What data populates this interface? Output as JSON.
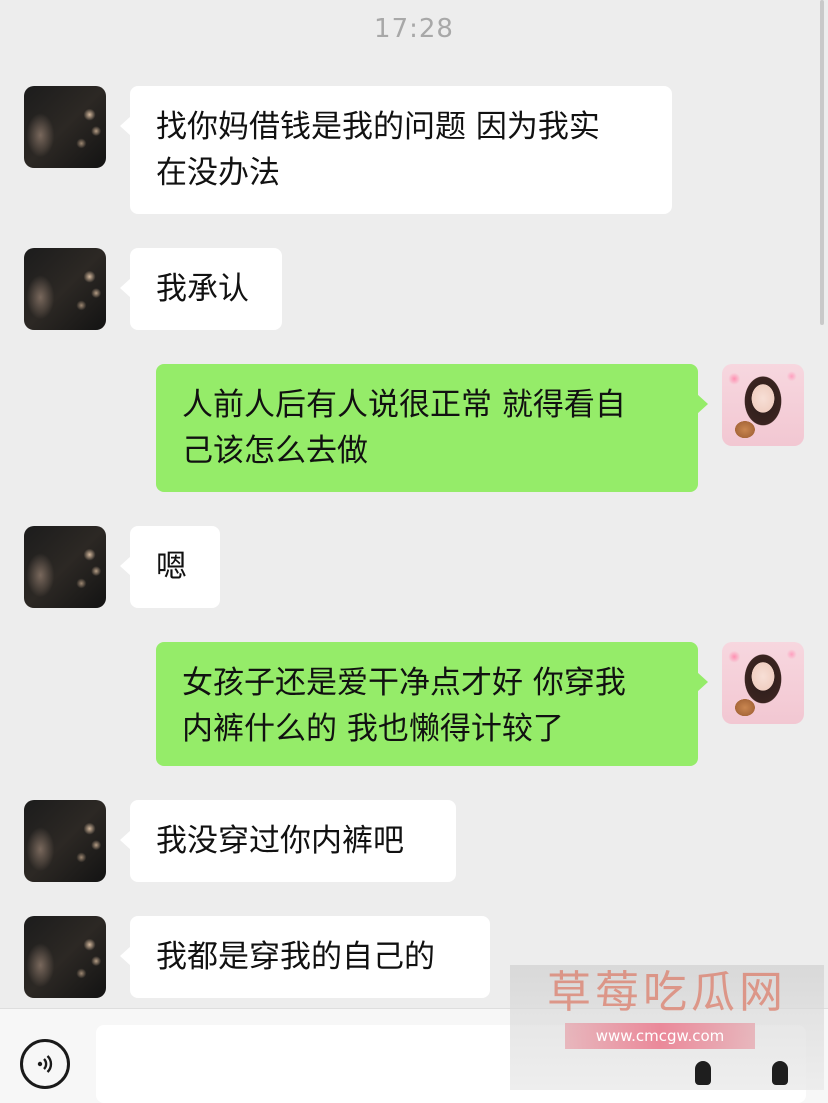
{
  "header": {
    "timestamp": "17:28"
  },
  "messages": [
    {
      "sender": "them",
      "text": "找你妈借钱是我的问题 因为我实在没办法",
      "lines": [
        "找你妈借钱是我的问题 因为我实",
        "在没办法"
      ]
    },
    {
      "sender": "them",
      "text": "我承认",
      "lines": [
        "我承认"
      ]
    },
    {
      "sender": "me",
      "text": "人前人后有人说很正常 就得看自己该怎么去做",
      "lines": [
        "人前人后有人说很正常 就得看自",
        "己该怎么去做"
      ]
    },
    {
      "sender": "them",
      "text": "嗯",
      "lines": [
        "嗯"
      ]
    },
    {
      "sender": "me",
      "text": "女孩子还是爱干净点才好 你穿我内裤什么的 我也懒得计较了",
      "lines": [
        "女孩子还是爱干净点才好 你穿我",
        "内裤什么的 我也懒得计较了"
      ]
    },
    {
      "sender": "them",
      "text": "我没穿过你内裤吧",
      "lines": [
        "我没穿过你内裤吧"
      ]
    },
    {
      "sender": "them",
      "text": "我都是穿我的自己的",
      "lines": [
        "我都是穿我的自己的"
      ]
    }
  ],
  "input_bar": {
    "voice_icon": "voice-icon",
    "input_value": ""
  },
  "watermark": {
    "title": "草莓吃瓜网",
    "url": "www.cmcgw.com"
  },
  "colors": {
    "background": "#ededed",
    "my_bubble": "#95ec69",
    "their_bubble": "#ffffff"
  }
}
